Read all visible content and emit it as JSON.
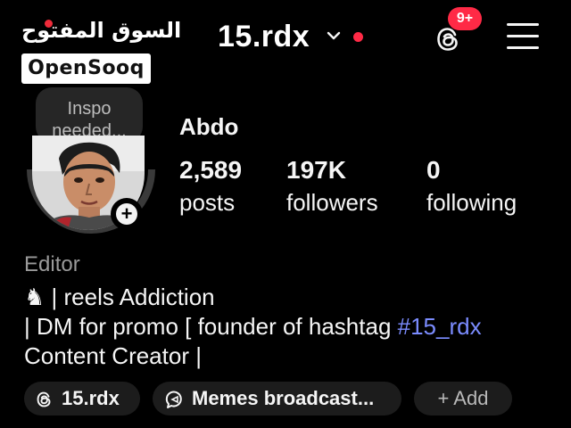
{
  "watermark": {
    "arabic": "السوق المفتوح",
    "latin": "OpenSooq"
  },
  "header": {
    "username": "15.rdx",
    "notification_badge": "9+",
    "colors": {
      "accent_red": "#ff2a46",
      "hashtag_blue": "#7b8cff"
    }
  },
  "note": {
    "text": "Inspo needed..."
  },
  "profile": {
    "name": "Abdo",
    "stats": [
      {
        "value": "2,589",
        "label": "posts"
      },
      {
        "value": "197K",
        "label": "followers"
      },
      {
        "value": "0",
        "label": "following"
      }
    ],
    "category": "Editor",
    "bio": {
      "line1_icon": "♞",
      "line1_text": " | reels Addiction",
      "line2_text": "| DM for promo [ founder of hashtag ",
      "line2_hashtag": "#15_rdx",
      "line3_text": "Content Creator |"
    }
  },
  "links": [
    {
      "icon": "threads-icon",
      "label": "15.rdx"
    },
    {
      "icon": "broadcast-icon",
      "label": "Memes broadcast..."
    },
    {
      "icon": "plus-icon",
      "label": "+ Add"
    }
  ]
}
